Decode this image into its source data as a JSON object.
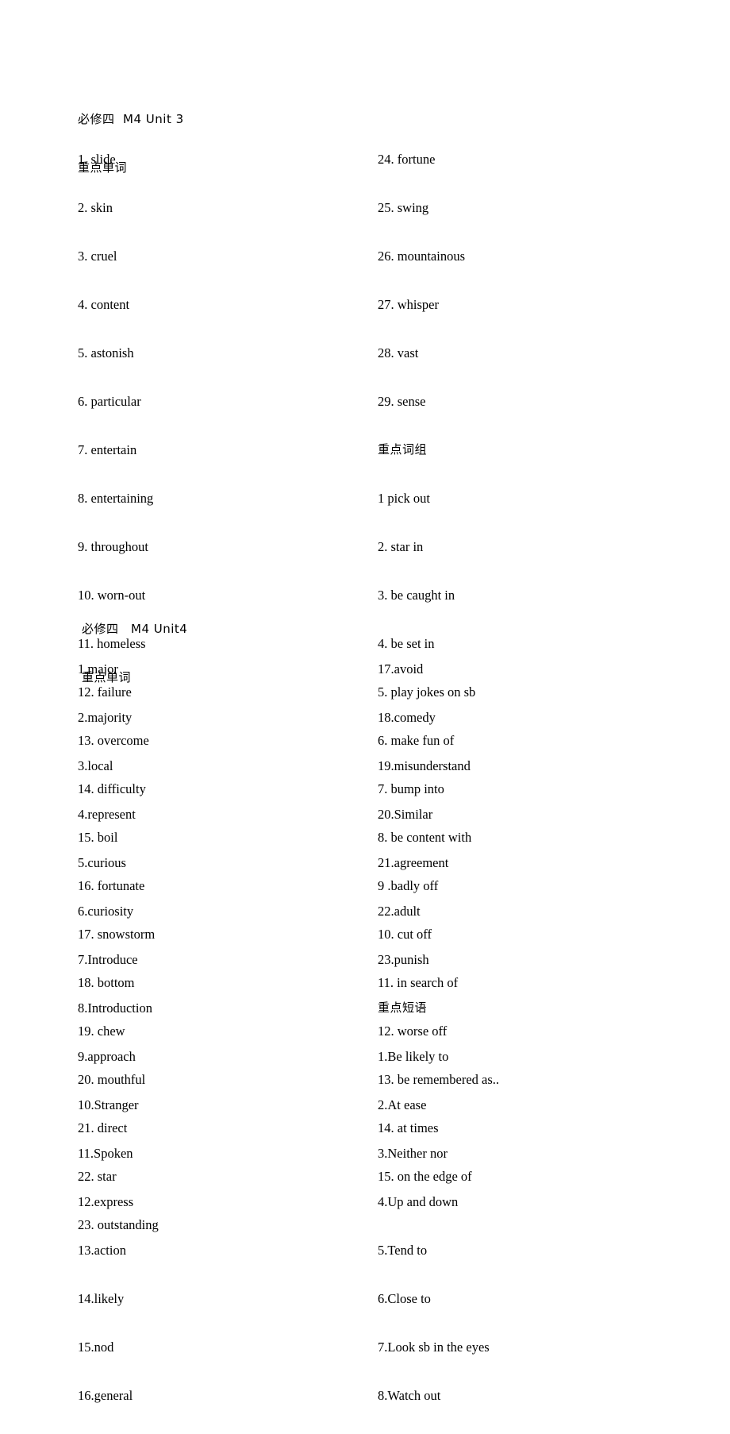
{
  "document": {
    "page_background": "#ffffff",
    "text_color": "#000000"
  },
  "sections": [
    {
      "id": "unit3",
      "title": "必修四  M4 Unit 3",
      "words_heading": "重点单词",
      "phrases_heading": "重点词组",
      "left_column": [
        "1. slide",
        "2. skin",
        "3. cruel",
        "4. content",
        "5. astonish",
        "6. particular",
        "7. entertain",
        "8. entertaining",
        "9. throughout",
        "10. worn-out",
        "11. homeless",
        "12. failure",
        "13. overcome",
        "14. difficulty",
        "15. boil",
        "16. fortunate",
        "17. snowstorm",
        "18. bottom",
        "19. chew",
        "20. mouthful",
        "21. direct",
        "22. star",
        "23. outstanding"
      ],
      "right_column_words": [
        "24. fortune",
        "25. swing",
        "26. mountainous",
        "27. whisper",
        "28. vast",
        "29. sense"
      ],
      "right_column_phrases": [
        "1 pick out",
        "2. star in",
        "3. be caught in",
        "4. be set in",
        "5. play jokes on sb",
        "6. make fun of",
        "7. bump into",
        "8. be content with",
        "9 .badly off",
        "10. cut off",
        "11. in search of",
        "12. worse off",
        "13. be remembered as..",
        "14. at times",
        "15. on the edge of"
      ]
    },
    {
      "id": "unit4",
      "title": "必修四　M4 Unit4",
      "words_heading": "重点单词",
      "phrases_heading": "重点短语",
      "left_column": [
        "1.major",
        "2.majority",
        "3.local",
        "4.represent",
        "5.curious",
        "6.curiosity",
        "7.Introduce",
        "8.Introduction",
        "9.approach",
        "10.Stranger",
        "11.Spoken",
        "12.express",
        "13.action",
        "14.likely",
        "15.nod",
        "16.general"
      ],
      "right_column_words": [
        "17.avoid",
        "18.comedy",
        "19.misunderstand",
        "20.Similar",
        "21.agreement",
        "22.adult",
        "23.punish"
      ],
      "right_column_phrases": [
        "1.Be likely to",
        "2.At ease",
        "3.Neither nor",
        "4.Up and down",
        "5.Tend to",
        "6.Close to",
        "7.Look sb in the eyes",
        "8.Watch out"
      ]
    }
  ]
}
